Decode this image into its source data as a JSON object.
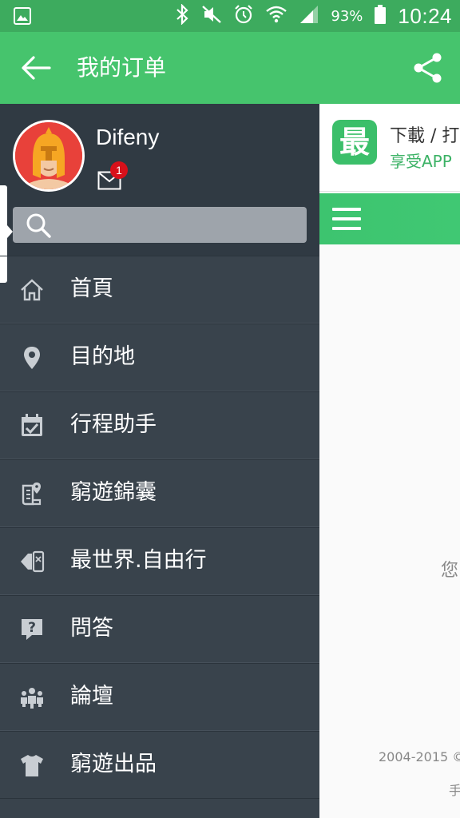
{
  "status_bar": {
    "battery_percent": "93%",
    "time": "10:24",
    "icons": [
      "gallery-icon",
      "bluetooth-icon",
      "mute-icon",
      "alarm-icon",
      "wifi-icon",
      "signal-icon",
      "battery-icon"
    ]
  },
  "app_bar": {
    "title": "我的订单",
    "back_icon": "arrow-left-icon",
    "share_icon": "share-icon"
  },
  "drawer": {
    "username": "Difeny",
    "mail_badge_count": "1",
    "search_placeholder": "",
    "items": [
      {
        "label": "首頁",
        "icon": "home-icon"
      },
      {
        "label": "目的地",
        "icon": "location-pin-icon"
      },
      {
        "label": "行程助手",
        "icon": "calendar-check-icon"
      },
      {
        "label": "窮遊錦囊",
        "icon": "guidebook-icon"
      },
      {
        "label": "最世界.自由行",
        "icon": "ticket-icon"
      },
      {
        "label": "問答",
        "icon": "question-icon"
      },
      {
        "label": "論壇",
        "icon": "community-icon"
      },
      {
        "label": "窮遊出品",
        "icon": "shirt-icon"
      }
    ]
  },
  "content": {
    "promo_logo": "最",
    "promo_title": "下載 / 打",
    "promo_subtitle": "享受APP",
    "body_text": "您",
    "footer_copyright": "2004-2015 ©",
    "footer_sub": "手"
  },
  "colors": {
    "status_bar": "#3dab5e",
    "app_bar": "#46c46d",
    "drawer": "#39434c",
    "drawer_header": "#303a43",
    "badge": "#d8101a"
  }
}
